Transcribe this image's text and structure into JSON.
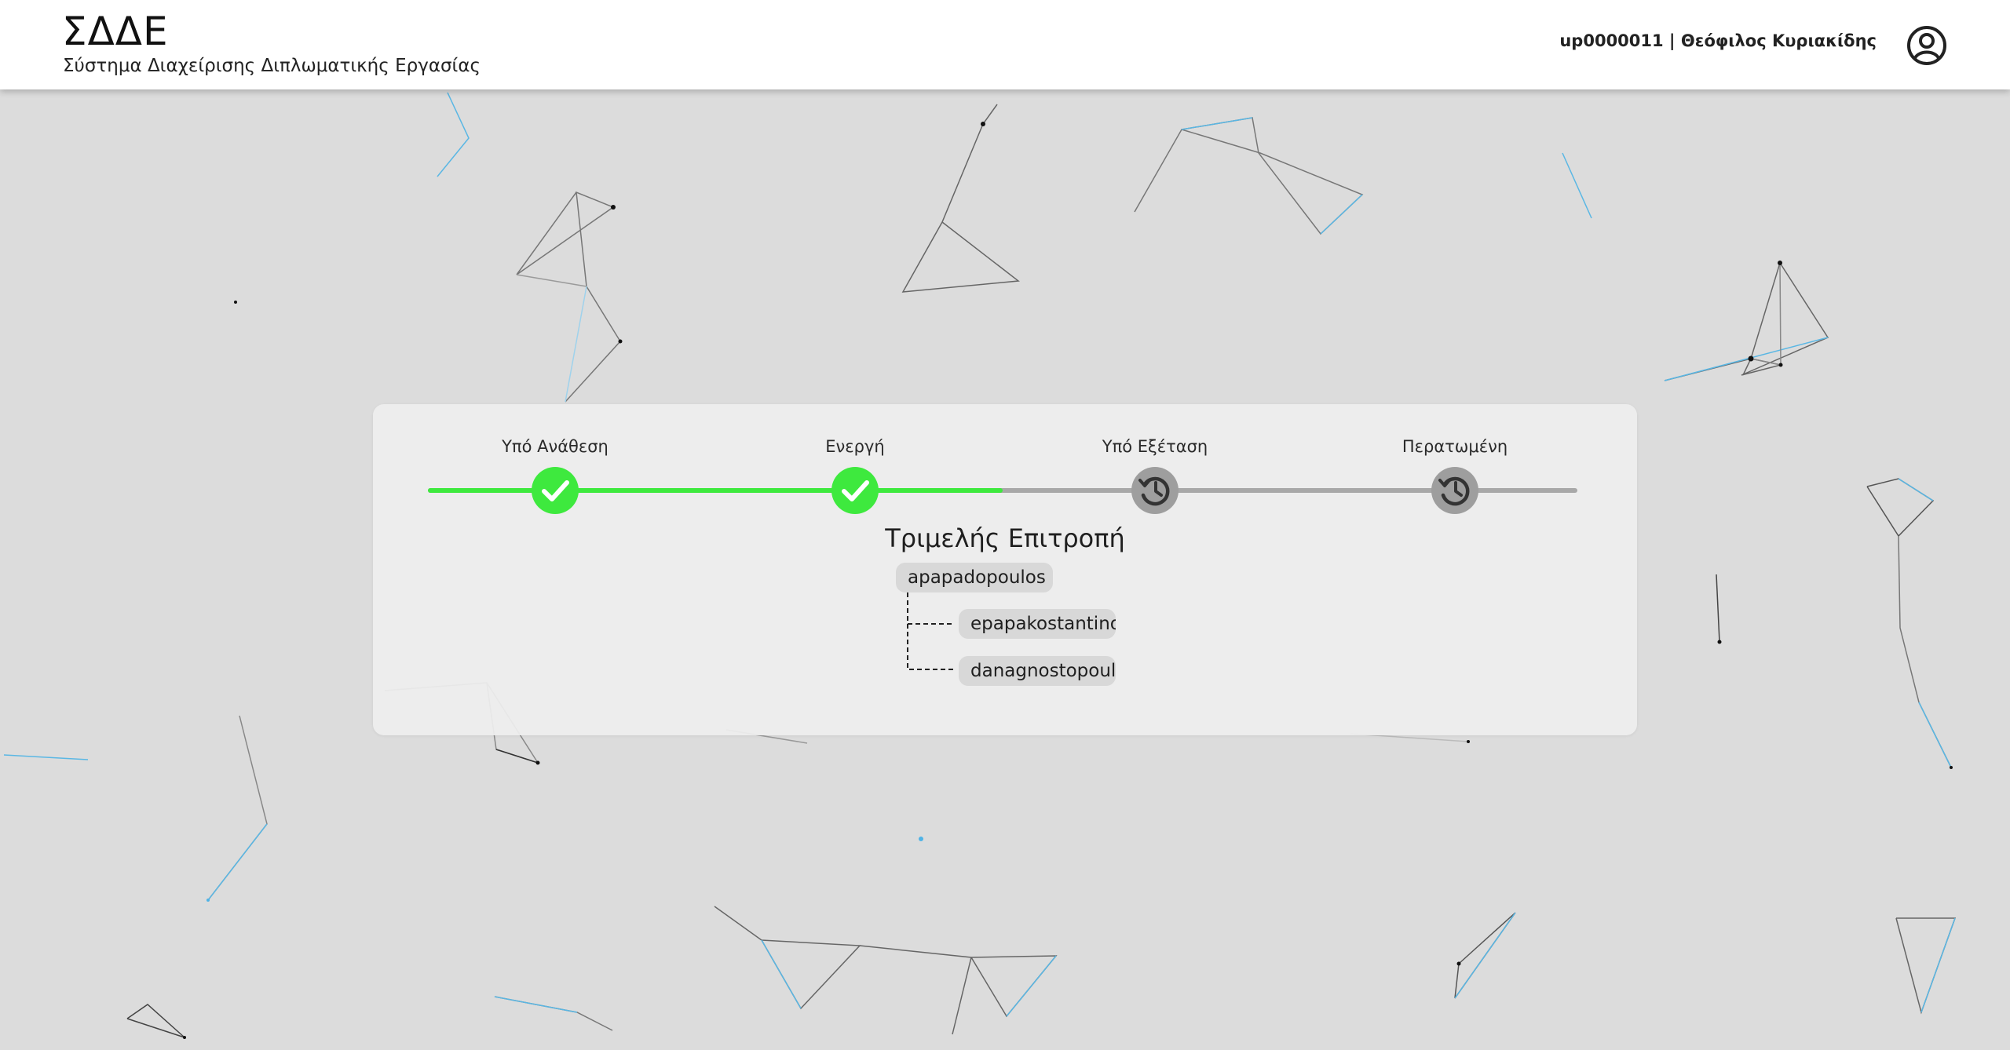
{
  "header": {
    "title": "ΣΔΔΕ",
    "subtitle": "Σύστημα Διαχείρισης Διπλωματικής Εργασίας",
    "user": "up0000011 | Θεόφιλος Κυριακίδης",
    "avatar_icon": "user-circle-icon"
  },
  "progress": {
    "steps": [
      {
        "label": "Υπό Ανάθεση",
        "status": "completed",
        "icon": "check-icon"
      },
      {
        "label": "Ενεργή",
        "status": "completed",
        "icon": "check-icon"
      },
      {
        "label": "Υπό Εξέταση",
        "status": "pending",
        "icon": "history-icon"
      },
      {
        "label": "Περατωμένη",
        "status": "pending",
        "icon": "history-icon"
      }
    ],
    "completed_fraction": 0.5
  },
  "committee": {
    "title": "Τριμελής Επιτροπή",
    "supervisor": "apapadopoulos",
    "members": [
      "epapakostantinou",
      "danagnostopoulos"
    ]
  },
  "colors": {
    "completed": "#3ee93e",
    "pending": "#9e9e9e",
    "background": "#dcdcdc",
    "network_accent": "#4fb3e6"
  }
}
